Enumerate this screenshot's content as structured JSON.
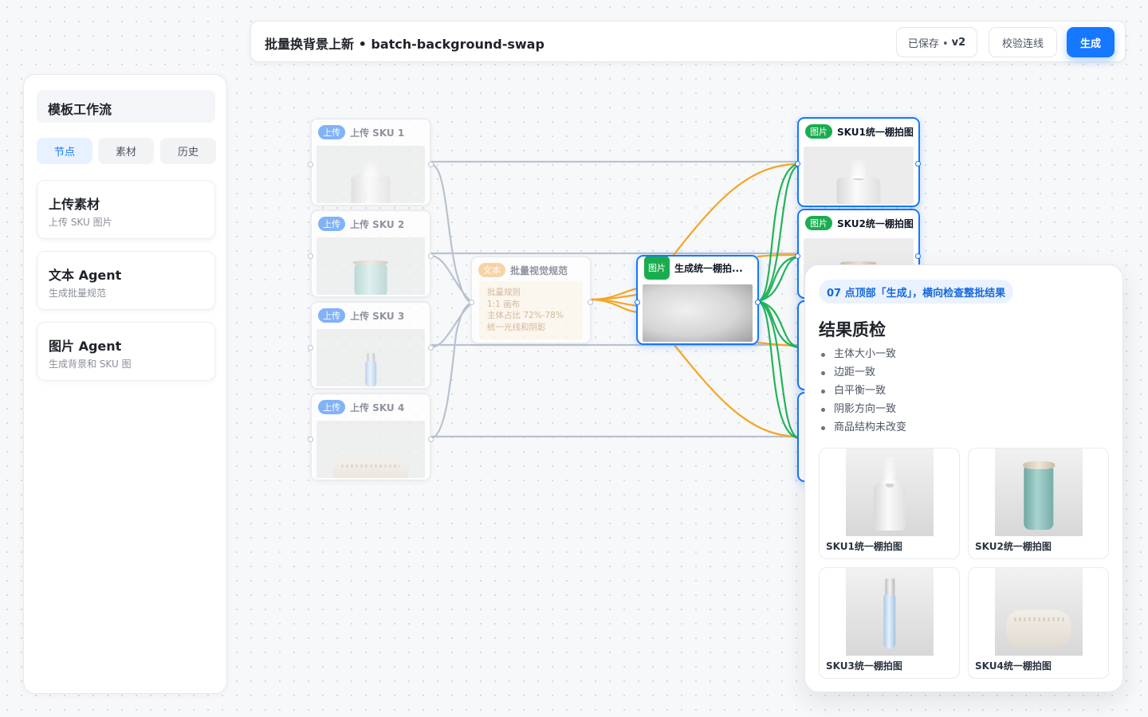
{
  "topbar": {
    "title": "批量换背景上新 • batch-background-swap",
    "saved_label": "已保存 •",
    "version": "v2",
    "validate_label": "校验连线",
    "generate_label": "生成"
  },
  "sidebar": {
    "title": "模板工作流",
    "tabs": [
      "节点",
      "素材",
      "历史"
    ],
    "active_tab": "节点",
    "cards": [
      {
        "title": "上传素材",
        "subtitle": "上传 SKU 图片"
      },
      {
        "title": "文本 Agent",
        "subtitle": "生成批量规范"
      },
      {
        "title": "图片 Agent",
        "subtitle": "生成背景和 SKU 图"
      }
    ]
  },
  "canvas": {
    "upload_nodes": [
      {
        "badge": "上传",
        "title": "上传 SKU 1",
        "product": "humidifier"
      },
      {
        "badge": "上传",
        "title": "上传 SKU 2",
        "product": "tumbler"
      },
      {
        "badge": "上传",
        "title": "上传 SKU 3",
        "product": "bottle"
      },
      {
        "badge": "上传",
        "title": "上传 SKU 4",
        "product": "speaker"
      }
    ],
    "text_node": {
      "badge": "文本",
      "title": "批量视觉规范",
      "lines": [
        "批量规则",
        "1:1 画布",
        "主体占比 72%-78%",
        "统一光线和阴影"
      ]
    },
    "generate_node": {
      "badge": "图片",
      "title": "生成统一棚拍..."
    },
    "output_nodes": [
      {
        "badge": "图片",
        "title": "SKU1统一棚拍图",
        "product": "humidifier"
      },
      {
        "badge": "图片",
        "title": "SKU2统一棚拍图",
        "product": "tumbler"
      }
    ],
    "edge_colors": {
      "gray": "#b8c2d0",
      "orange": "#f5a623",
      "green": "#22b45a"
    }
  },
  "panel": {
    "step": "07 点顶部「生成」，横向检查整批结果",
    "title": "结果质检",
    "checklist": [
      "主体大小一致",
      "边距一致",
      "白平衡一致",
      "阴影方向一致",
      "商品结构未改变"
    ],
    "results": [
      {
        "label": "SKU1统一棚拍图",
        "product": "humidifier"
      },
      {
        "label": "SKU2统一棚拍图",
        "product": "tumbler"
      },
      {
        "label": "SKU3统一棚拍图",
        "product": "bottle"
      },
      {
        "label": "SKU4统一棚拍图",
        "product": "speaker"
      }
    ]
  }
}
